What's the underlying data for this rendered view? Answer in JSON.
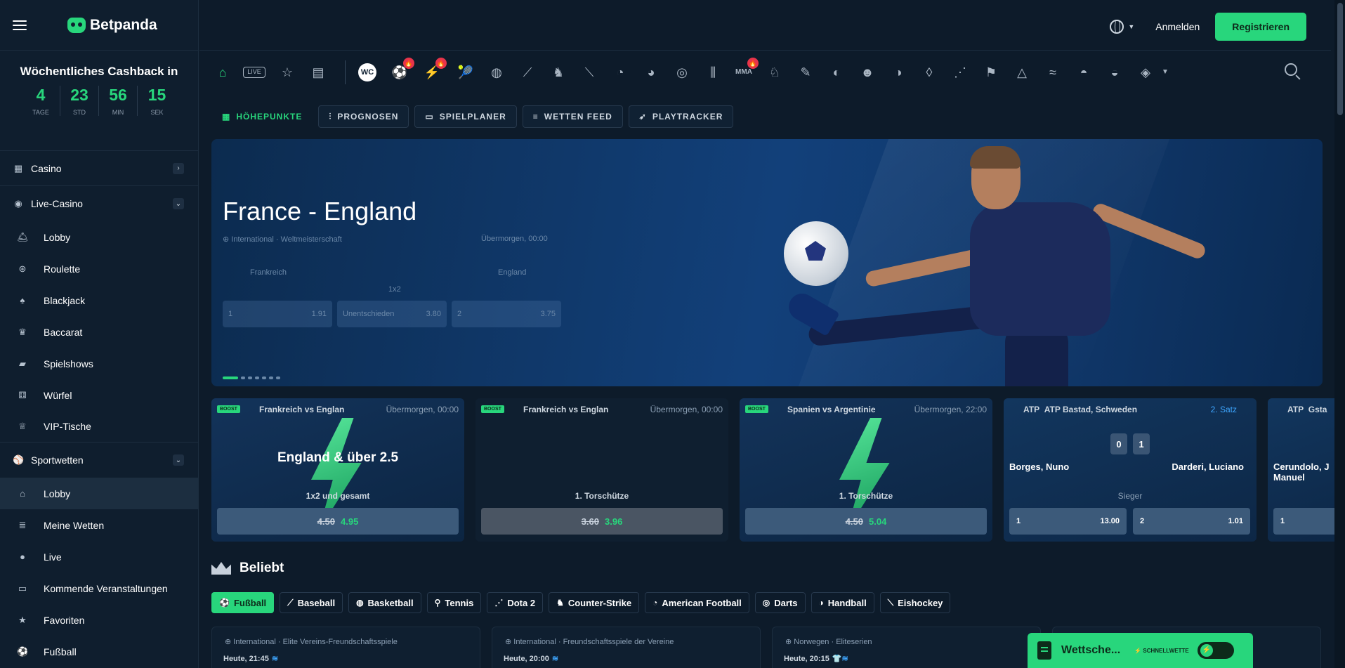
{
  "brand": {
    "name": "Betpanda"
  },
  "cashback": {
    "title": "Wöchentliches Cashback in",
    "units": [
      {
        "value": "4",
        "label": "TAGE"
      },
      {
        "value": "23",
        "label": "STD"
      },
      {
        "value": "56",
        "label": "MIN"
      },
      {
        "value": "15",
        "label": "SEK"
      }
    ]
  },
  "sidebar": {
    "casino": "Casino",
    "live_casino": "Live-Casino",
    "live_items": [
      "Lobby",
      "Roulette",
      "Blackjack",
      "Baccarat",
      "Spielshows",
      "Würfel",
      "VIP-Tische"
    ],
    "sportwetten": "Sportwetten",
    "sport_items": [
      "Lobby",
      "Meine Wetten",
      "Live",
      "Kommende Veranstaltungen",
      "Favoriten",
      "Fußball"
    ]
  },
  "header": {
    "login": "Anmelden",
    "register": "Registrieren"
  },
  "tabs": [
    "HÖHEPUNKTE",
    "PROGNOSEN",
    "SPIELPLANER",
    "WETTEN FEED",
    "PLAYTRACKER"
  ],
  "hero": {
    "title": "France - England",
    "meta": "International · Weltmeisterschaft",
    "time": "Übermorgen, 00:00",
    "team1": "Frankreich",
    "team2": "England",
    "market": "1x2",
    "odds": [
      {
        "label": "1",
        "value": "1.91"
      },
      {
        "label": "Unentschieden",
        "value": "3.80"
      },
      {
        "label": "2",
        "value": "3.75"
      }
    ]
  },
  "cards": [
    {
      "badge": "BOOST",
      "match": "Frankreich vs Englan",
      "time": "Übermorgen, 00:00",
      "main": "England & über 2.5",
      "sub": "1x2 und gesamt",
      "old": "4.50",
      "new": "4.95"
    },
    {
      "badge": "BOOST",
      "match": "Frankreich vs Englan",
      "time": "Übermorgen, 00:00",
      "main": "",
      "sub": "1. Torschütze",
      "old": "3.60",
      "new": "3.96"
    },
    {
      "badge": "BOOST",
      "match": "Spanien vs Argentinie",
      "time": "Übermorgen, 22:00",
      "main": "",
      "sub": "1. Torschütze",
      "old": "4.50",
      "new": "5.04"
    }
  ],
  "tennis": {
    "tour": "ATP",
    "event": "ATP Bastad, Schweden",
    "set": "2. Satz",
    "player1": "Borges, Nuno",
    "player2": "Darderi, Luciano",
    "score1": "0",
    "score2": "1",
    "market": "Sieger",
    "odds": [
      {
        "label": "1",
        "value": "13.00"
      },
      {
        "label": "2",
        "value": "1.01"
      }
    ]
  },
  "tennis2": {
    "tour": "ATP",
    "event": "Gsta",
    "player": "Cerundolo, J",
    "player_line2": "Manuel",
    "odd_label": "1"
  },
  "beliebt": {
    "title": "Beliebt",
    "sports": [
      "Fußball",
      "Baseball",
      "Basketball",
      "Tennis",
      "Dota 2",
      "Counter-Strike",
      "American Football",
      "Darts",
      "Handball",
      "Eishockey"
    ]
  },
  "matches": [
    {
      "league": "International · Elite Vereins-Freundschaftsspiele",
      "time": "Heute, 21:45"
    },
    {
      "league": "International · Freundschaftsspiele der Vereine",
      "time": "Heute, 20:00"
    },
    {
      "league": "Norwegen · Eliteserien",
      "time": "Heute, 20:15"
    }
  ],
  "betslip": {
    "title": "Wettsche...",
    "quick": "SCHNELLWETTE"
  },
  "colors": {
    "accent": "#28d67c",
    "bg": "#0d1b2a",
    "fire": "#e8344a",
    "link": "#3ea6ff"
  }
}
